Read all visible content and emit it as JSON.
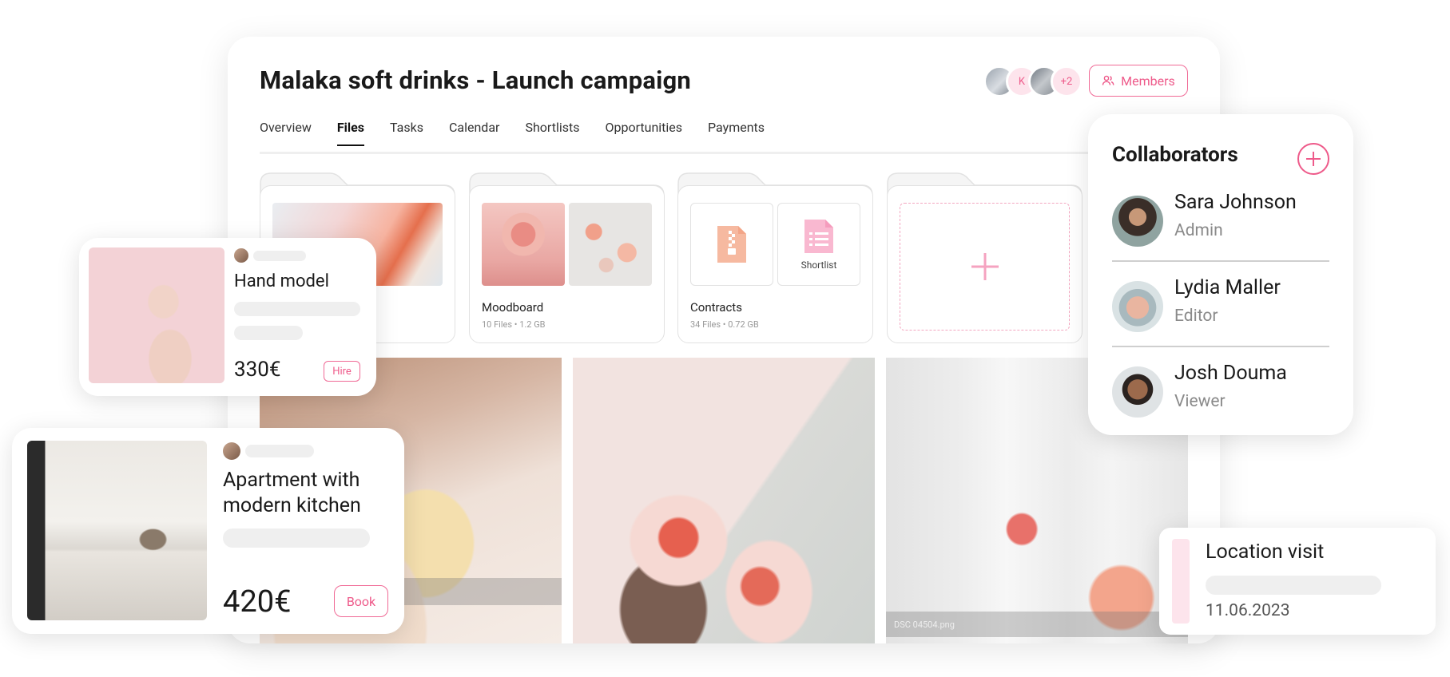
{
  "project": {
    "title": "Malaka soft drinks - Launch campaign",
    "members_label": "Members",
    "avatars": [
      "",
      "K",
      "",
      "+2"
    ]
  },
  "tabs": [
    {
      "label": "Overview",
      "active": false
    },
    {
      "label": "Files",
      "active": true
    },
    {
      "label": "Tasks",
      "active": false
    },
    {
      "label": "Calendar",
      "active": false
    },
    {
      "label": "Shortlists",
      "active": false
    },
    {
      "label": "Opportunities",
      "active": false
    },
    {
      "label": "Payments",
      "active": false
    }
  ],
  "folders": {
    "moodboard": {
      "name": "Moodboard",
      "meta": "10 Files • 1.2 GB"
    },
    "contracts": {
      "name": "Contracts",
      "meta": "34 Files • 0.72 GB",
      "tile_label": "Shortlist"
    }
  },
  "photos": {
    "third_caption": "DSC 04504.png"
  },
  "hand_card": {
    "title": "Hand model",
    "price": "330€",
    "button": "Hire"
  },
  "apartment_card": {
    "title": "Apartment with modern kitchen",
    "price": "420€",
    "button": "Book"
  },
  "collaborators": {
    "title": "Collaborators",
    "people": [
      {
        "name": "Sara Johnson",
        "role": "Admin"
      },
      {
        "name": "Lydia Maller",
        "role": "Editor"
      },
      {
        "name": "Josh Douma",
        "role": "Viewer"
      }
    ]
  },
  "location_card": {
    "title": "Location visit",
    "date": "11.06.2023"
  },
  "colors": {
    "accent": "#ee5a8a",
    "accent_light": "#fde4ec"
  }
}
